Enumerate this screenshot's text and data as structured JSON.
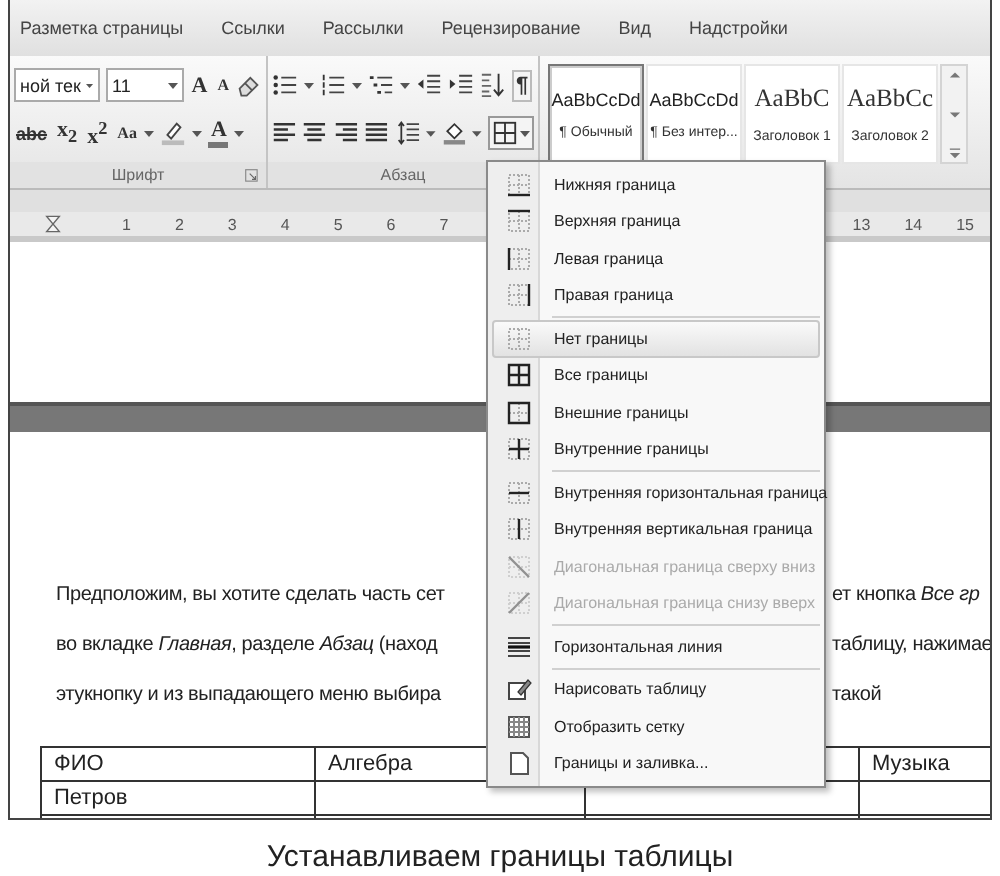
{
  "ribbon_tabs": [
    {
      "label": "Разметка страницы"
    },
    {
      "label": "Ссылки"
    },
    {
      "label": "Рассылки"
    },
    {
      "label": "Рецензирование"
    },
    {
      "label": "Вид"
    },
    {
      "label": "Надстройки"
    }
  ],
  "font_group": {
    "label": "Шрифт",
    "font_name": "ной тек",
    "font_size": "11",
    "grow_button": "A",
    "shrink_button": "A",
    "strikethrough_button": "abc",
    "subscript_button": "x$_{2}$",
    "superscript_button": "x$^{2}$",
    "case_button": "Aa",
    "font_color_button": "A"
  },
  "paragraph_group": {
    "label": "Абзац",
    "pilcrow_button": "¶"
  },
  "styles": [
    {
      "sample": "AaBbCcDd",
      "name": "¶ Обычный",
      "kind": "body",
      "selected": true
    },
    {
      "sample": "AaBbCcDd",
      "name": "¶ Без интер...",
      "kind": "body",
      "selected": false
    },
    {
      "sample": "AaBbC",
      "name": "Заголовок 1",
      "kind": "heading",
      "selected": false
    },
    {
      "sample": "AaBbCc",
      "name": "Заголовок 2",
      "kind": "heading",
      "selected": false
    }
  ],
  "ruler": {
    "left_numbers": [
      "1",
      "2",
      "3",
      "4",
      "5",
      "6",
      "7"
    ],
    "right_numbers": [
      "13",
      "14",
      "15"
    ]
  },
  "paragraph": [
    {
      "left": "Предположим, вы хотите сделать часть сет",
      "right": "ет кнопка *Все гр*"
    },
    {
      "left": "во вкладке *Главная*, разделе *Абзац* (наход",
      "right": "таблицу, нажимае"
    },
    {
      "left": "этукнопку и из выпадающего меню выбира",
      "right": "такой"
    }
  ],
  "table": {
    "columns": [
      {
        "label": "ФИО"
      },
      {
        "label": "Алгебра"
      },
      {},
      {
        "label": "Музыка"
      }
    ],
    "rows": [
      [
        "Петров"
      ]
    ]
  },
  "borders_menu": {
    "groups": [
      [
        {
          "label": "Нижняя граница",
          "kind": "bottom",
          "selected": false,
          "disabled": false
        },
        {
          "label": "Верхняя граница",
          "kind": "top",
          "selected": false,
          "disabled": false
        },
        {
          "label": "Левая граница",
          "kind": "left",
          "selected": false,
          "disabled": false
        },
        {
          "label": "Правая граница",
          "kind": "right",
          "selected": false,
          "disabled": false
        }
      ],
      [
        {
          "label": "Нет границы",
          "kind": "none",
          "selected": true,
          "disabled": false
        },
        {
          "label": "Все границы",
          "kind": "all",
          "selected": false,
          "disabled": false
        },
        {
          "label": "Внешние границы",
          "kind": "outside",
          "selected": false,
          "disabled": false
        },
        {
          "label": "Внутренние границы",
          "kind": "inside",
          "selected": false,
          "disabled": false
        }
      ],
      [
        {
          "label": "Внутренняя горизонтальная граница",
          "kind": "inside-h",
          "selected": false,
          "disabled": false
        },
        {
          "label": "Внутренняя вертикальная граница",
          "kind": "inside-v",
          "selected": false,
          "disabled": false
        },
        {
          "label": "Диагональная граница сверху вниз",
          "kind": "diag-down",
          "selected": false,
          "disabled": true
        },
        {
          "label": "Диагональная граница снизу вверх",
          "kind": "diag-up",
          "selected": false,
          "disabled": true
        }
      ],
      [
        {
          "label": "Горизонтальная линия",
          "kind": "hline",
          "selected": false,
          "disabled": false
        }
      ],
      [
        {
          "label": "Нарисовать таблицу",
          "kind": "draw",
          "selected": false,
          "disabled": false
        },
        {
          "label": "Отобразить сетку",
          "kind": "grid",
          "selected": false,
          "disabled": false
        },
        {
          "label": "Границы и заливка...",
          "kind": "dialog",
          "selected": false,
          "disabled": false
        }
      ]
    ]
  },
  "caption": "Устанавливаем границы таблицы"
}
